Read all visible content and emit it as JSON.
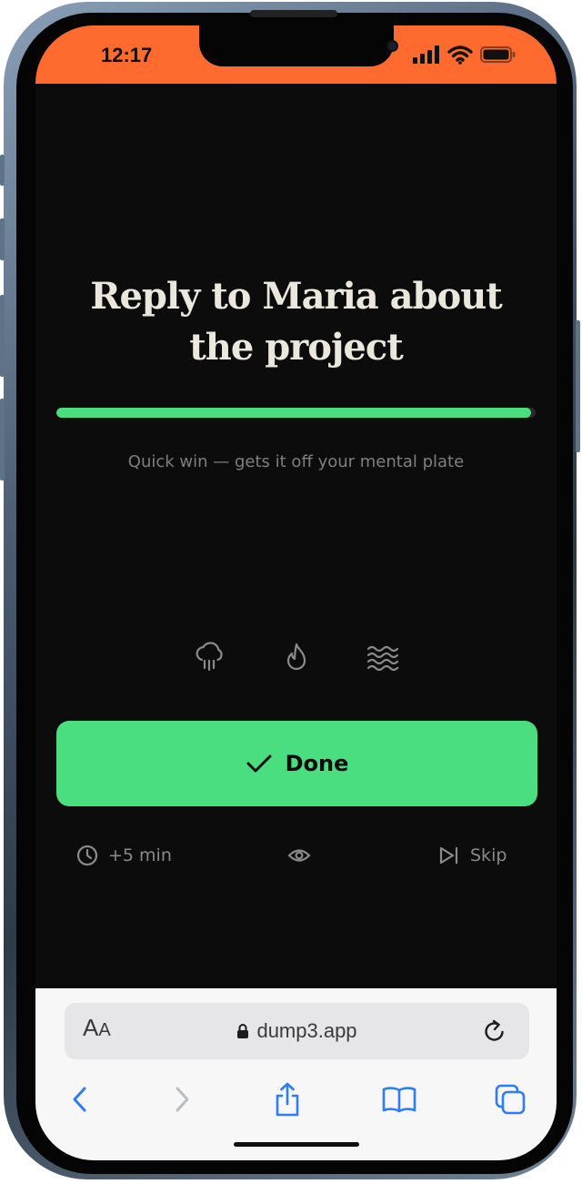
{
  "status_bar": {
    "time": "12:17",
    "background": "#ff6b2e"
  },
  "task": {
    "title": "Reply to Maria about the project",
    "progress": 0.99,
    "subtitle": "Quick win — gets it off your mental plate",
    "progress_color": "#4ade80"
  },
  "energy_icons": [
    "cloud-rain-icon",
    "flame-icon",
    "waves-icon"
  ],
  "actions": {
    "done_label": "Done",
    "snooze_label": "+5 min",
    "skip_label": "Skip"
  },
  "browser": {
    "aa_big": "A",
    "aa_small": "A",
    "url": "dump3.app"
  },
  "theme": {
    "accent": "#4ade80",
    "screen_bg": "#0c0c0c",
    "title_color": "#ece7dd"
  }
}
